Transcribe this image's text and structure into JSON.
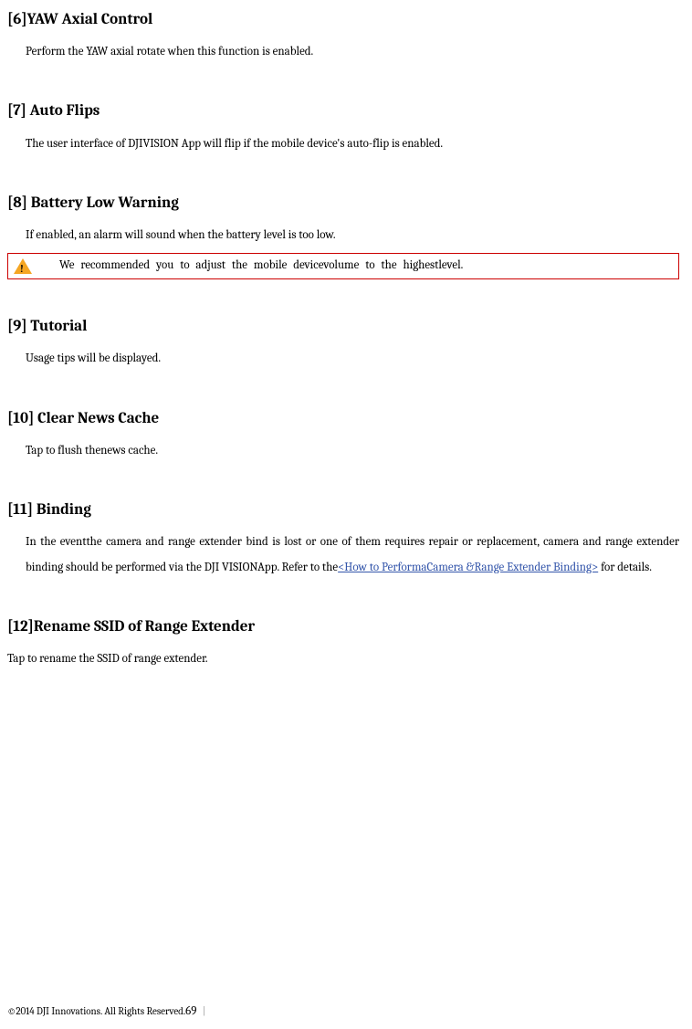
{
  "sections": {
    "s6": {
      "title": "[6]YAW Axial Control",
      "body": "Perform the YAW axial rotate when this function is enabled."
    },
    "s7": {
      "title": "[7] Auto Flips",
      "body": "The user interface of DJIVISION App will flip if the mobile device's auto-flip is enabled."
    },
    "s8": {
      "title": "[8] Battery Low Warning",
      "body": "If enabled, an alarm will sound when the battery level is too low.",
      "warn": "We recommended you to adjust the mobile devicevolume to the highestlevel."
    },
    "s9": {
      "title": "[9] Tutorial",
      "body": "Usage tips will be displayed."
    },
    "s10": {
      "title": "[10] Clear News Cache",
      "body": "Tap to flush thenews cache."
    },
    "s11": {
      "title": "[11] Binding",
      "body_pre": "In the eventthe camera and range extender bind is lost or one of them requires repair or replacement, camera and range extender binding should be performed via the DJI VISIONApp. Refer to the",
      "link": "<How to PerformaCamera &Range Extender Binding>",
      "body_post": " for details."
    },
    "s12": {
      "title": "[12]Rename SSID of Range Extender",
      "body": "Tap to rename the SSID of range extender."
    }
  },
  "footer": {
    "copyright": "©2014 DJI Innovations. All Rights Reserved.",
    "page": "69",
    "bar": "|"
  }
}
